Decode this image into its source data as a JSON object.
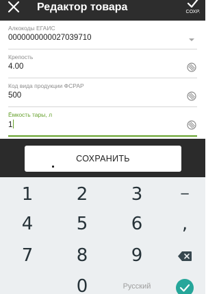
{
  "app_bar": {
    "title": "Редактор товара",
    "save_label": "СОХР.",
    "close_icon": "close-icon",
    "save_icon": "check-icon"
  },
  "form": {
    "fields": [
      {
        "label": "Алкокоды ЕГАИС",
        "value": "0000000000027039710",
        "icon": "dropdown-arrow-icon"
      },
      {
        "label": "Крепость",
        "value": "4.00",
        "icon": "clear-icon"
      },
      {
        "label": "Код вида продукции ФСРАР",
        "value": "500",
        "icon": "clear-icon"
      },
      {
        "label": "Ёмкость тары, л",
        "value": "1",
        "icon": "clear-icon"
      }
    ]
  },
  "save_button": {
    "label": "СОХРАНИТЬ"
  },
  "keyboard": {
    "rows": [
      [
        "1",
        "2",
        "3",
        "−"
      ],
      [
        "4",
        "5",
        "6",
        ","
      ],
      [
        "7",
        "8",
        "9",
        "backspace"
      ],
      [
        "",
        "0",
        "Русский",
        "done"
      ]
    ],
    "language": "Русский",
    "accent_color": "#26a69a"
  },
  "colors": {
    "app_bar": "#2d2d2d",
    "active_field": "#64a02a",
    "button_bar": "#2b2b2b",
    "keyboard": "#eceff1"
  }
}
